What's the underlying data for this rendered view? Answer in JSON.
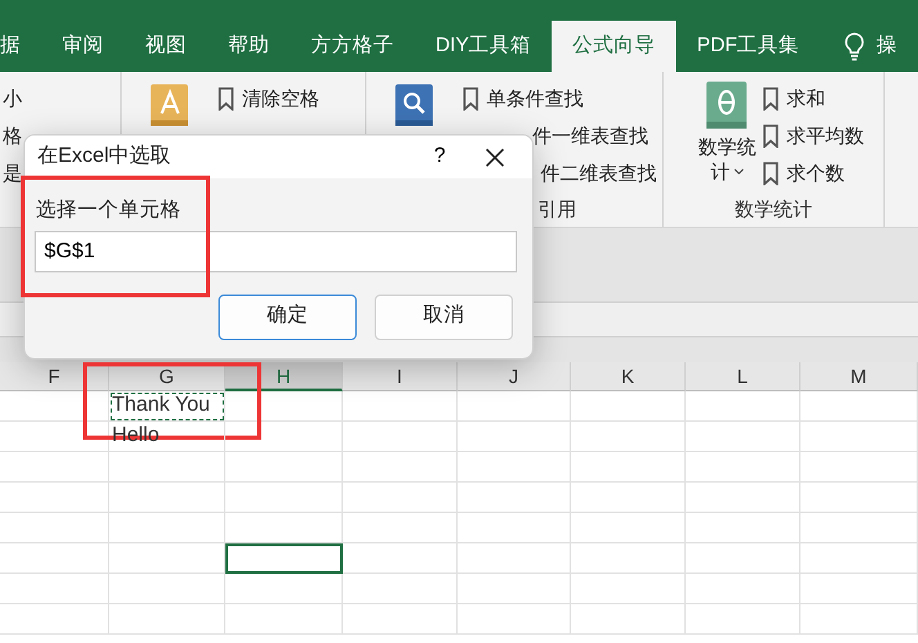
{
  "ribbon_tabs": [
    {
      "label": "据",
      "selected": false
    },
    {
      "label": "审阅",
      "selected": false
    },
    {
      "label": "视图",
      "selected": false
    },
    {
      "label": "帮助",
      "selected": false
    },
    {
      "label": "方方格子",
      "selected": false
    },
    {
      "label": "DIY工具箱",
      "selected": false
    },
    {
      "label": "公式向导",
      "selected": true
    },
    {
      "label": "PDF工具集",
      "selected": false
    }
  ],
  "tell_me": {
    "label": "操"
  },
  "ribbon_groups": [
    {
      "kind": "list",
      "items": [
        "小",
        "格",
        "是"
      ]
    },
    {
      "kind": "icon-list",
      "items": [
        "清除空格"
      ]
    },
    {
      "kind": "icon-list",
      "items": [
        "单条件查找",
        "件一维表查找",
        "件二维表查找"
      ],
      "label": "引用"
    },
    {
      "kind": "big-list",
      "button_label": "数学统",
      "button_label_2": "计",
      "items": [
        "求和",
        "求平均数",
        "求个数"
      ],
      "label": "数学统计"
    }
  ],
  "sheet": {
    "columns": [
      {
        "label": "F",
        "selected": false
      },
      {
        "label": "G",
        "selected": false,
        "cells": [
          {
            "text": "Thank You",
            "copy_marquee": true
          },
          {
            "text": "Hello",
            "copy_marquee": false
          }
        ]
      },
      {
        "label": "H",
        "selected": true
      },
      {
        "label": "I",
        "selected": false
      },
      {
        "label": "J",
        "selected": false
      },
      {
        "label": "K",
        "selected": false
      },
      {
        "label": "L",
        "selected": false
      },
      {
        "label": "M",
        "selected": false
      }
    ]
  },
  "dialog": {
    "title": "在Excel中选取",
    "help": "?",
    "field_label": "选择一个单元格",
    "field_value": "$G$1",
    "buttons": [
      {
        "label": "确定",
        "default": true
      },
      {
        "label": "取消",
        "default": false
      }
    ]
  }
}
